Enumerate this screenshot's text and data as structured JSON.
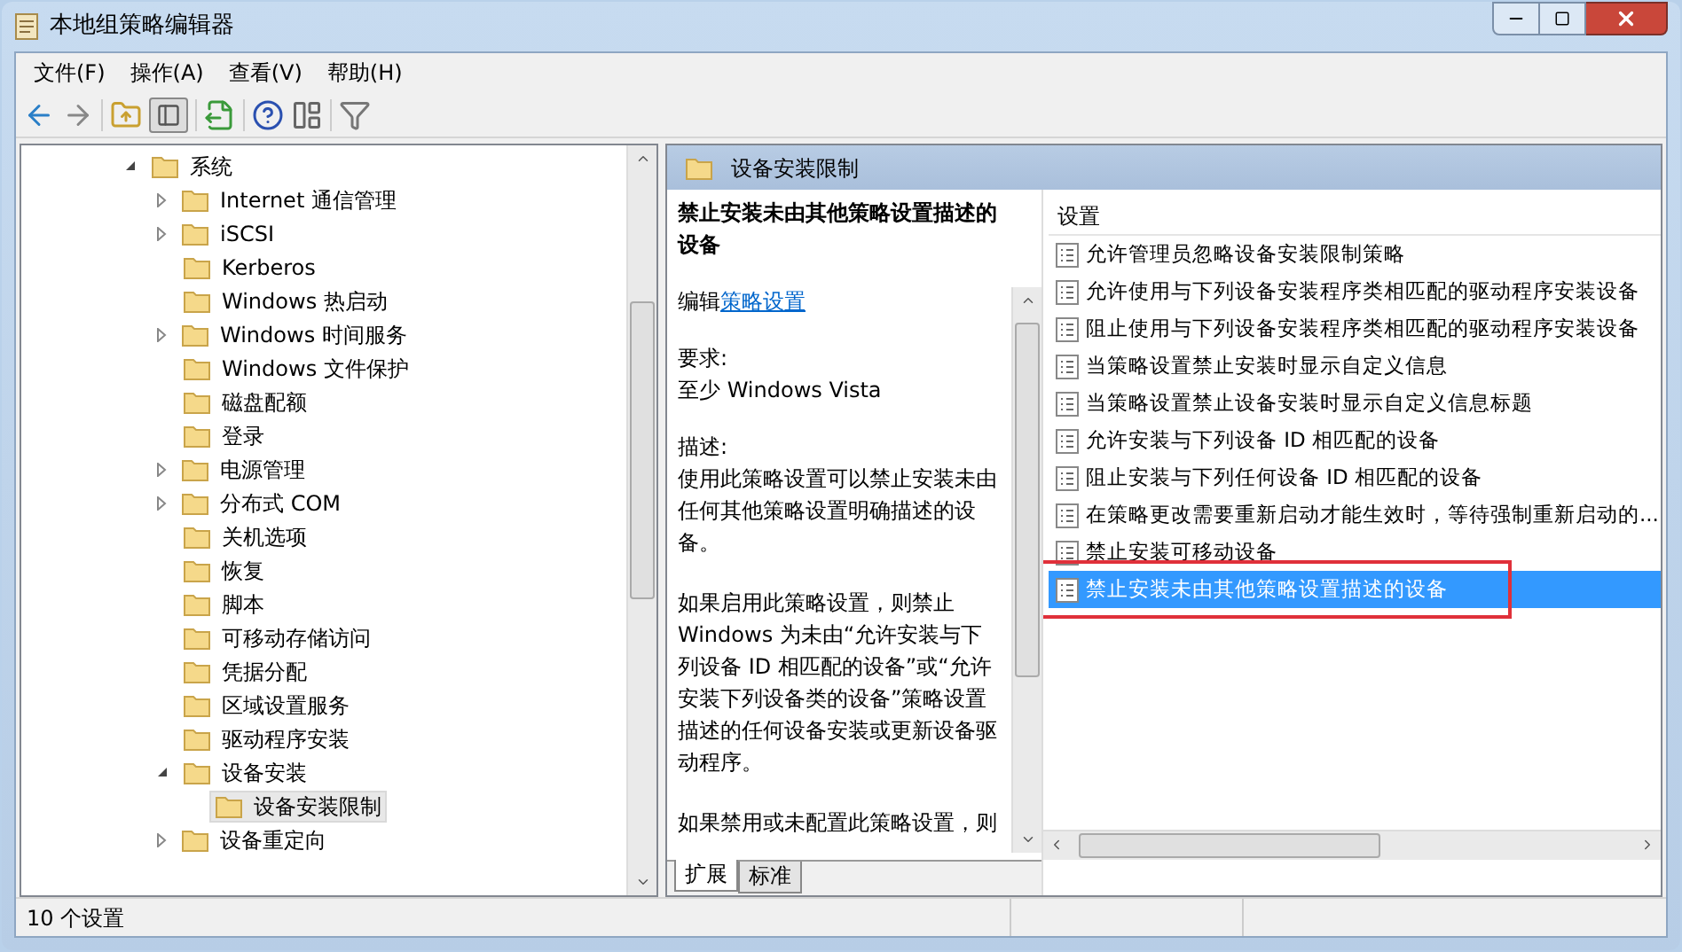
{
  "window": {
    "title": "本地组策略编辑器"
  },
  "menu": [
    "文件(F)",
    "操作(A)",
    "查看(V)",
    "帮助(H)"
  ],
  "tree": {
    "label": "系统",
    "expandable": true,
    "expanded": true,
    "selected": false,
    "children": [
      {
        "label": "Internet 通信管理",
        "expandable": true,
        "expanded": false,
        "selected": false
      },
      {
        "label": "iSCSI",
        "expandable": true,
        "expanded": false,
        "selected": false
      },
      {
        "label": "Kerberos",
        "expandable": false,
        "selected": false
      },
      {
        "label": "Windows 热启动",
        "expandable": false,
        "selected": false
      },
      {
        "label": "Windows 时间服务",
        "expandable": true,
        "expanded": false,
        "selected": false
      },
      {
        "label": "Windows 文件保护",
        "expandable": false,
        "selected": false
      },
      {
        "label": "磁盘配额",
        "expandable": false,
        "selected": false
      },
      {
        "label": "登录",
        "expandable": false,
        "selected": false
      },
      {
        "label": "电源管理",
        "expandable": true,
        "expanded": false,
        "selected": false
      },
      {
        "label": "分布式 COM",
        "expandable": true,
        "expanded": false,
        "selected": false
      },
      {
        "label": "关机选项",
        "expandable": false,
        "selected": false
      },
      {
        "label": "恢复",
        "expandable": false,
        "selected": false
      },
      {
        "label": "脚本",
        "expandable": false,
        "selected": false
      },
      {
        "label": "可移动存储访问",
        "expandable": false,
        "selected": false
      },
      {
        "label": "凭据分配",
        "expandable": false,
        "selected": false
      },
      {
        "label": "区域设置服务",
        "expandable": false,
        "selected": false
      },
      {
        "label": "驱动程序安装",
        "expandable": false,
        "selected": false
      },
      {
        "label": "设备安装",
        "expandable": true,
        "expanded": true,
        "selected": false,
        "children": [
          {
            "label": "设备安装限制",
            "expandable": false,
            "selected": true
          }
        ]
      },
      {
        "label": "设备重定向",
        "expandable": true,
        "expanded": false,
        "selected": false
      }
    ]
  },
  "details": {
    "folder_title": "设备安装限制",
    "heading": "禁止安装未由其他策略设置描述的设备",
    "edit_prefix": "编辑",
    "edit_link": "策略设置",
    "requirement_label": "要求:",
    "requirement": "至少 Windows Vista",
    "description_label": "描述:",
    "paragraphs": [
      "使用此策略设置可以禁止安装未由任何其他策略设置明确描述的设备。",
      "如果启用此策略设置，则禁止 Windows 为未由“允许安装与下列设备 ID 相匹配的设备”或“允许安装下列设备类的设备”策略设置描述的任何设备安装或更新设备驱动程序。",
      "如果禁用或未配置此策略设置，则"
    ]
  },
  "settings": {
    "column": "设置",
    "items": [
      {
        "label": "允许管理员忽略设备安装限制策略",
        "selected": false
      },
      {
        "label": "允许使用与下列设备安装程序类相匹配的驱动程序安装设备",
        "selected": false
      },
      {
        "label": "阻止使用与下列设备安装程序类相匹配的驱动程序安装设备",
        "selected": false
      },
      {
        "label": "当策略设置禁止安装时显示自定义信息",
        "selected": false
      },
      {
        "label": "当策略设置禁止设备安装时显示自定义信息标题",
        "selected": false
      },
      {
        "label": "允许安装与下列设备 ID 相匹配的设备",
        "selected": false
      },
      {
        "label": "阻止安装与下列任何设备 ID 相匹配的设备",
        "selected": false
      },
      {
        "label": "在策略更改需要重新启动才能生效时，等待强制重新启动的...",
        "selected": false
      },
      {
        "label": "禁止安装可移动设备",
        "selected": false
      },
      {
        "label": "禁止安装未由其他策略设置描述的设备",
        "selected": true
      }
    ]
  },
  "view_tabs": [
    {
      "label": "扩展",
      "selected": true
    },
    {
      "label": "标准",
      "selected": false
    }
  ],
  "status_bar": "10 个设置"
}
